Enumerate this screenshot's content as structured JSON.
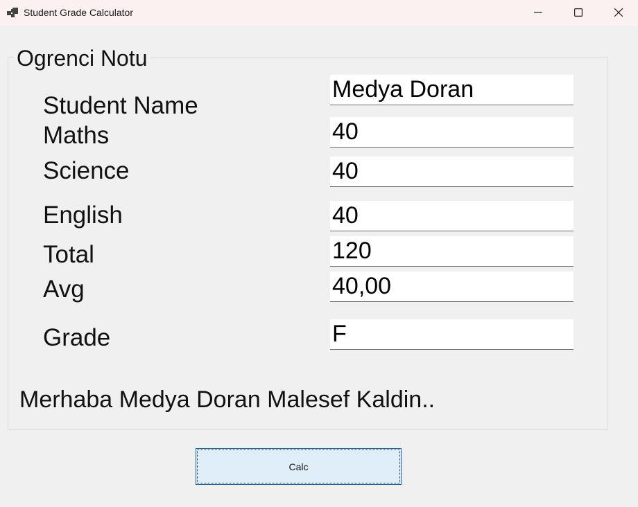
{
  "window": {
    "title": "Student Grade Calculator",
    "icon": "app-window-icon",
    "controls": [
      "minimize-icon",
      "maximize-icon",
      "close-icon"
    ]
  },
  "group": {
    "title": "Ogrenci Notu"
  },
  "fields": {
    "student_name": {
      "label": "Student Name",
      "value": "Medya Doran"
    },
    "maths": {
      "label": "Maths",
      "value": "40"
    },
    "science": {
      "label": "Science",
      "value": "40"
    },
    "english": {
      "label": "English",
      "value": "40"
    },
    "total": {
      "label": "Total",
      "value": "120"
    },
    "avg": {
      "label": "Avg",
      "value": "40,00"
    },
    "grade": {
      "label": "Grade",
      "value": "F"
    }
  },
  "message": "Merhaba Medya Doran Malesef Kaldin..",
  "calc_button": {
    "label": "Calc"
  },
  "colors": {
    "titlebar": "#faf1f0",
    "window_bg": "#f0f0f0",
    "button_bg": "#e0eef9",
    "button_border": "#0a64c8"
  }
}
